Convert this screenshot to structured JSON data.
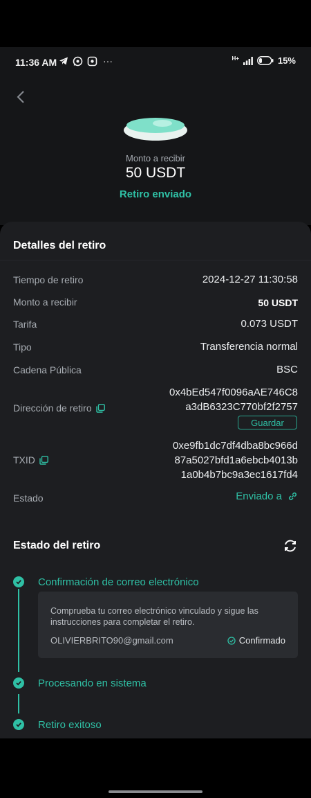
{
  "status_bar": {
    "time": "11:36 AM",
    "more": "···",
    "network": "H+",
    "battery": "15%"
  },
  "hero": {
    "amount_label": "Monto a recibir",
    "amount": "50 USDT",
    "status": "Retiro enviado"
  },
  "details": {
    "title": "Detalles del retiro",
    "rows": [
      {
        "label": "Tiempo de retiro",
        "value": "2024-12-27 11:30:58"
      },
      {
        "label": "Monto a recibir",
        "value": "50 USDT"
      },
      {
        "label": "Tarifa",
        "value": "0.073 USDT"
      },
      {
        "label": "Tipo",
        "value": "Transferencia normal"
      },
      {
        "label": "Cadena Pública",
        "value": "BSC"
      }
    ],
    "address": {
      "label": "Dirección de retiro",
      "line1": "0x4bEd547f0096aAE746C8",
      "line2": "a3dB6323C770bf2f2757",
      "save_label": "Guardar"
    },
    "txid": {
      "label": "TXID",
      "line1": "0xe9fb1dc7df4dba8bc966d",
      "line2": "87a5027bfd1a6ebcb4013b",
      "line3": "1a0b4b7bc9a3ec1617fd4"
    },
    "estado": {
      "label": "Estado",
      "value": "Enviado a"
    }
  },
  "progress": {
    "title": "Estado del retiro",
    "steps": [
      {
        "label": "Confirmación de correo electrónico"
      },
      {
        "label": "Procesando en sistema"
      },
      {
        "label": "Retiro exitoso"
      }
    ],
    "info": {
      "message": "Comprueba tu correo electrónico vinculado y sigue las instrucciones para completar el retiro.",
      "email": "OLIVIERBRITO90@gmail.com",
      "confirmed": "Confirmado"
    }
  },
  "colors": {
    "accent": "#2fc0a5",
    "background": "#151618",
    "card": "#1d1e21"
  }
}
